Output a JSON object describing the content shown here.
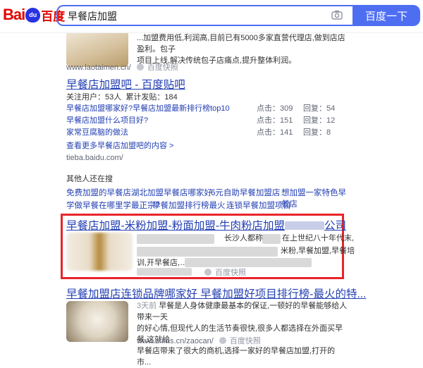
{
  "header": {
    "logo_bai": "Bai",
    "logo_du": "du",
    "logo_cn": "百度",
    "search_value": "早餐店加盟",
    "search_button": "百度一下"
  },
  "result1": {
    "snippet_line1": "...加盟费用低,利润高,目前已有5000多家直营代理店,做到店店盈利。包子",
    "snippet_line2": "项目上线,解决传统包子店痛点,提升整体利润。",
    "url": "www.laotaimen.cn/",
    "snapshot": "百度快照"
  },
  "tieba": {
    "title": "早餐店加盟吧 - 百度贴吧",
    "followers": "关注用户：53人",
    "posts": "累计发贴：184",
    "rows": [
      {
        "title": "早餐店加盟哪家好?早餐店加盟最新排行榜top10",
        "clicks": "点击：309",
        "replies": "回复：54"
      },
      {
        "title": "早餐店加盟什么项目好?",
        "clicks": "点击：151",
        "replies": "回复：12"
      },
      {
        "title": "家常豆腐脑的做法",
        "clicks": "点击：141",
        "replies": "回复：8"
      }
    ],
    "more": "查看更多早餐店加盟吧的内容 >",
    "url": "tieba.baidu.com/"
  },
  "related": {
    "heading": "其他人还在搜",
    "row1": [
      "免费加盟的早餐店",
      "湖北加盟早餐店哪家好",
      "6元自助早餐加盟店",
      "想加盟一家特色早餐店"
    ],
    "row2": [
      "学做早餐在哪里学最正宗?",
      "早餐加盟排行榜最火",
      "连锁早餐加盟项目"
    ]
  },
  "result_highlight": {
    "title": "早餐店加盟-米粉加盟-粉面加盟-牛肉粉店加盟",
    "title_tail": "公司",
    "snippet_a": "长沙人都称",
    "snippet_b": "在上世纪八十年代末,",
    "snippet_c": "米粉,早餐加盟,早餐培",
    "snippet_d": "训,开早餐店,…",
    "snapshot": "百度快照"
  },
  "result_last": {
    "title": "早餐加盟店连锁品牌哪家好 早餐加盟好项目排行榜-最火的特...",
    "date": "3天前",
    "snippet1": "早餐是人身体健康最基本的保证,一顿好的早餐能够给人带来一天",
    "snippet2": "的好心情,但现代人的生活节奏很快,很多人都选择在外面买早餐,这就给",
    "snippet3": "早餐店带来了很大的商机,选择一家好的早餐店加盟,打开的市...",
    "url": "www.zhms.cn/zaocan/",
    "snapshot": "百度快照"
  },
  "colors": {
    "brand_blue": "#4e6ef2",
    "link": "#2440b3",
    "highlight_red": "#f73131",
    "annotation_border": "#e9242a"
  }
}
